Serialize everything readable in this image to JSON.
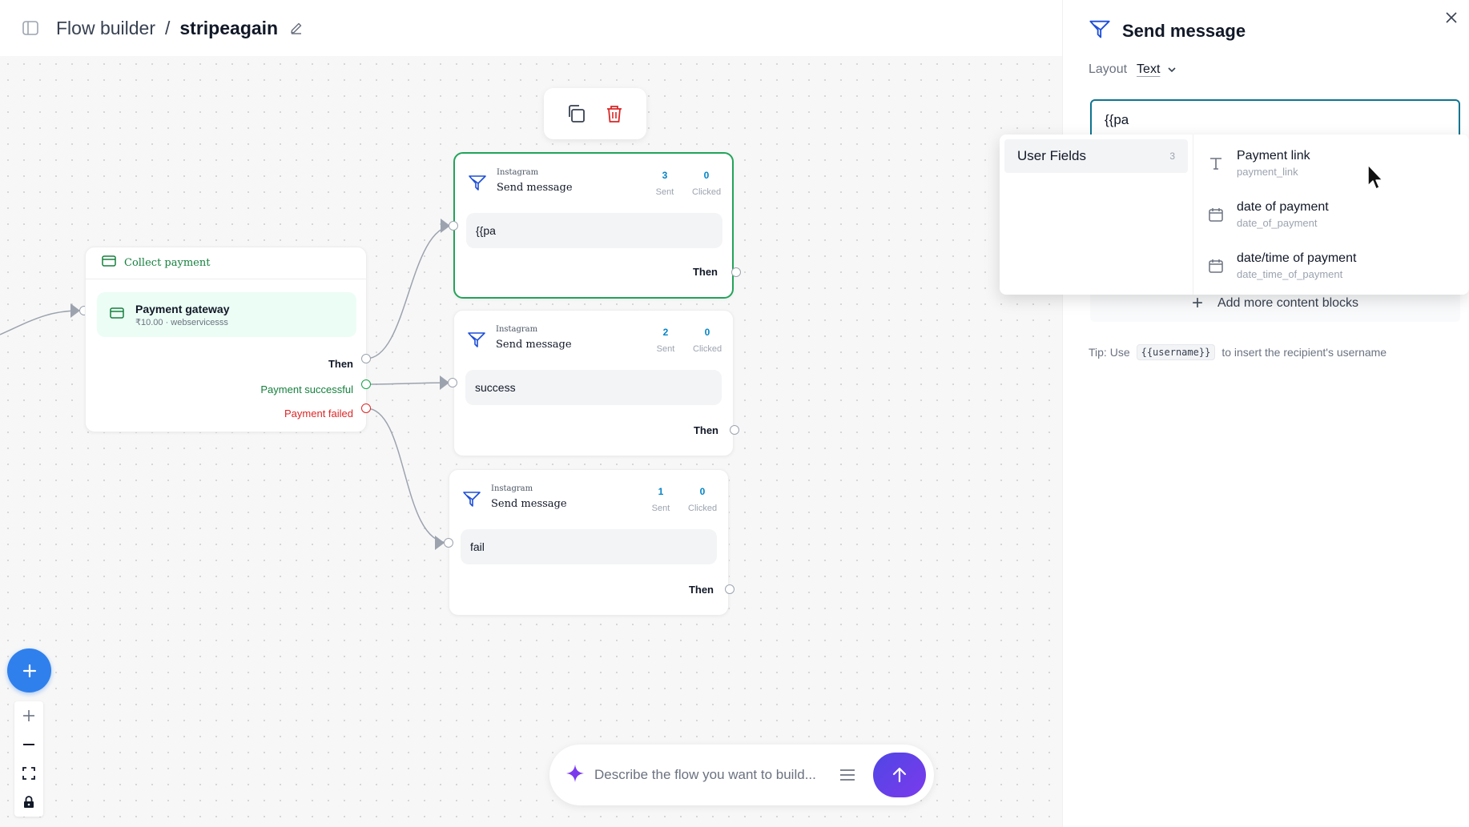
{
  "header": {
    "breadcrumb_root": "Flow builder",
    "separator": "/",
    "flow_name": "stripeagain"
  },
  "collect_node": {
    "title": "Collect payment",
    "gateway_title": "Payment gateway",
    "gateway_sub": "₹10.00 · webservicesss",
    "out_then": "Then",
    "out_success": "Payment successful",
    "out_failed": "Payment failed"
  },
  "message_nodes": [
    {
      "platform": "Instagram",
      "title": "Send message",
      "sent": "3",
      "sent_label": "Sent",
      "clicked": "0",
      "clicked_label": "Clicked",
      "body": "{{pa",
      "then": "Then"
    },
    {
      "platform": "Instagram",
      "title": "Send message",
      "sent": "2",
      "sent_label": "Sent",
      "clicked": "0",
      "clicked_label": "Clicked",
      "body": "success",
      "then": "Then"
    },
    {
      "platform": "Instagram",
      "title": "Send message",
      "sent": "1",
      "sent_label": "Sent",
      "clicked": "0",
      "clicked_label": "Clicked",
      "body": "fail",
      "then": "Then"
    }
  ],
  "prompt": {
    "placeholder": "Describe the flow you want to build..."
  },
  "panel": {
    "title": "Send message",
    "layout_label": "Layout",
    "layout_value": "Text",
    "input_value": "{{pa",
    "add_blocks": "Add more content blocks",
    "tip_prefix": "Tip: Use",
    "tip_code": "{{username}}",
    "tip_suffix": "to insert the recipient's username"
  },
  "suggestions": {
    "category": "User Fields",
    "count": "3",
    "items": [
      {
        "title": "Payment link",
        "key": "payment_link",
        "icon": "text-icon"
      },
      {
        "title": "date of payment",
        "key": "date_of_payment",
        "icon": "calendar-icon"
      },
      {
        "title": "date/time of payment",
        "key": "date_time_of_payment",
        "icon": "calendar-icon"
      }
    ]
  },
  "colors": {
    "accent_blue": "#2f80ed",
    "selected_border": "#22a35a",
    "success_green": "#15803d",
    "failed_red": "#dc2626",
    "send_gradient_start": "#4f46e5",
    "send_gradient_end": "#7c3aed"
  }
}
